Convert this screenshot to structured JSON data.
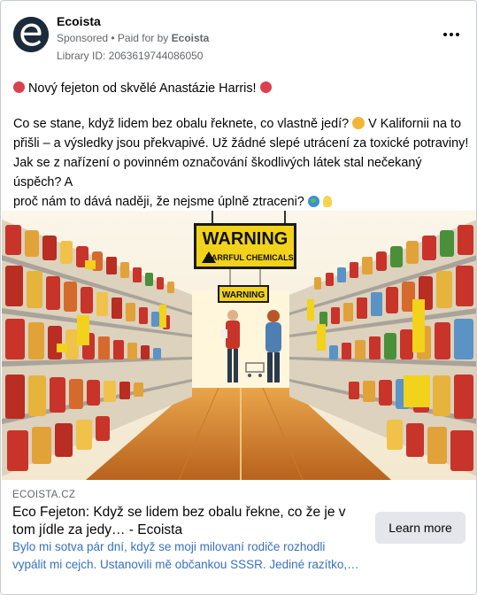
{
  "header": {
    "page_name": "Ecoista",
    "sponsored": "Sponsored",
    "paid_for_by": "• Paid for by",
    "payer": "Ecoista",
    "library_id": "Library ID: 2063619744086050",
    "avatar_letter": "e"
  },
  "post": {
    "headline": "Nový fejeton od skvělé Anastázie Harris!",
    "line1": "Co se stane, když lidem bez obalu řeknete, co vlastně jedí?",
    "line1b": "V Kalifornii na to",
    "line2": "přišli – a výsledky jsou překvapivé. Už žádné slepé utrácení za toxické potraviny!",
    "line3": "Jak se z nařízení o povinném označování škodlivých látek stal nečekaný úspěch? A",
    "line4": "proč nám to dává naději, že nejsme úplně ztraceni?",
    "ellipsis": "..."
  },
  "image": {
    "warning_big": "WARNING",
    "warning_sub": "HARRFUL CHEMICALS",
    "warning_small": "WARNING"
  },
  "link": {
    "domain": "ECOISTA.CZ",
    "title_line1": "Eco Fejeton: Když se lidem bez obalu řekne, co že je v",
    "title_line2": "tom jídle za jedy… - Ecoista",
    "desc_line1": "Bylo mi sotva pár dní, když se moji milovaní rodiče rozhodli",
    "desc_line2": "vypálit mi cejch. Ustanovili mě občankou SSSR. Jediné razítko,…",
    "cta": "Learn more"
  },
  "colors": {
    "warning_yellow": "#f2d21b",
    "link_blue": "#3670c2",
    "muted_gray": "#65676b"
  }
}
